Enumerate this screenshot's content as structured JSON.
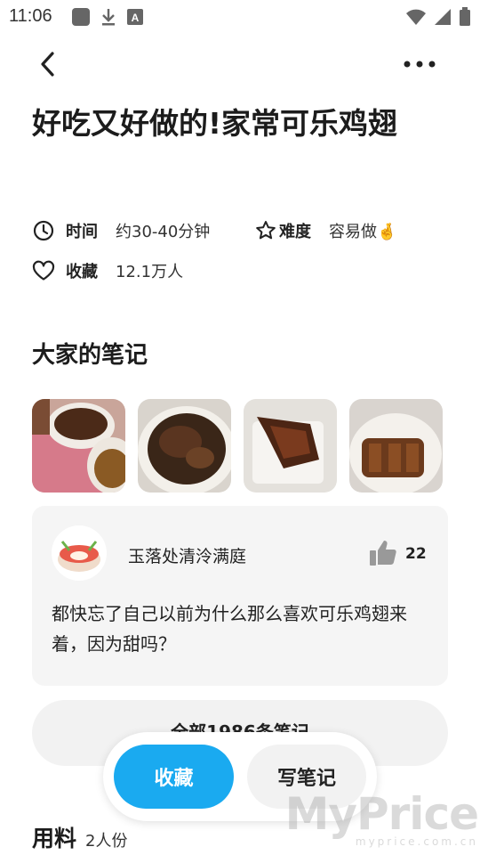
{
  "status_bar": {
    "time": "11:06"
  },
  "recipe": {
    "title": "好吃又好做的!家常可乐鸡翅",
    "time_label": "时间",
    "time_value": "约30-40分钟",
    "difficulty_label": "难度",
    "difficulty_value": "容易做🤞",
    "favorites_label": "收藏",
    "favorites_value": "12.1万人"
  },
  "notes_section": {
    "title": "大家的笔记",
    "photos": [
      "note-photo-1",
      "note-photo-2",
      "note-photo-3",
      "note-photo-4"
    ],
    "featured_note": {
      "author": "玉落处清泠满庭",
      "likes": "22",
      "text": "都快忘了自己以前为什么那么喜欢可乐鸡翅来着，因为甜吗？"
    },
    "all_notes_label": "全部1986条笔记"
  },
  "actions": {
    "favorite_label": "收藏",
    "write_note_label": "写笔记"
  },
  "ingredients": {
    "title": "用料",
    "servings": "2人份"
  },
  "watermark": {
    "big": "MyPrice",
    "small": "myprice.com.cn"
  },
  "colors": {
    "accent": "#1aaaf0",
    "card_bg": "#f5f5f5"
  }
}
